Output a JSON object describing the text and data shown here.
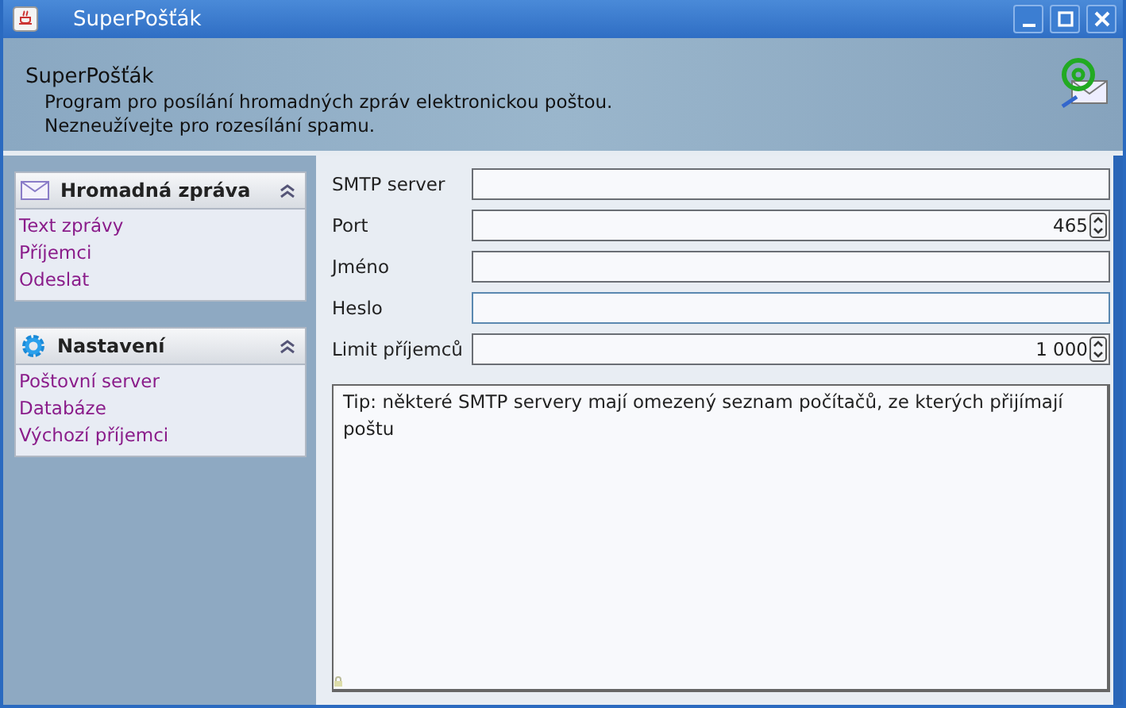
{
  "window": {
    "title": "SuperPošťák"
  },
  "header": {
    "title": "SuperPošťák",
    "lines": [
      "Program pro posílání hromadných zpráv elektronickou poštou.",
      "Nezneužívejte pro rozesílání spamu."
    ]
  },
  "sidebar": {
    "panels": [
      {
        "title": "Hromadná zpráva",
        "expanded": true,
        "items": [
          {
            "label": "Text zprávy"
          },
          {
            "label": "Příjemci"
          },
          {
            "label": "Odeslat"
          }
        ]
      },
      {
        "title": "Nastavení",
        "expanded": true,
        "items": [
          {
            "label": "Poštovní server"
          },
          {
            "label": "Databáze"
          },
          {
            "label": "Výchozí příjemci"
          }
        ]
      }
    ]
  },
  "form": {
    "fields": [
      {
        "label": "SMTP server",
        "kind": "text",
        "focused": false
      },
      {
        "label": "Port",
        "kind": "spinner",
        "value": "465",
        "focused": false
      },
      {
        "label": "Jméno",
        "kind": "text",
        "focused": false
      },
      {
        "label": "Heslo",
        "kind": "text",
        "focused": true
      },
      {
        "label": "Limit příjemců",
        "kind": "spinner",
        "value": "1 000",
        "focused": false
      }
    ],
    "tip": "Tip: některé SMTP servery mají omezený seznam počítačů, ze kterých přijímají poštu"
  }
}
